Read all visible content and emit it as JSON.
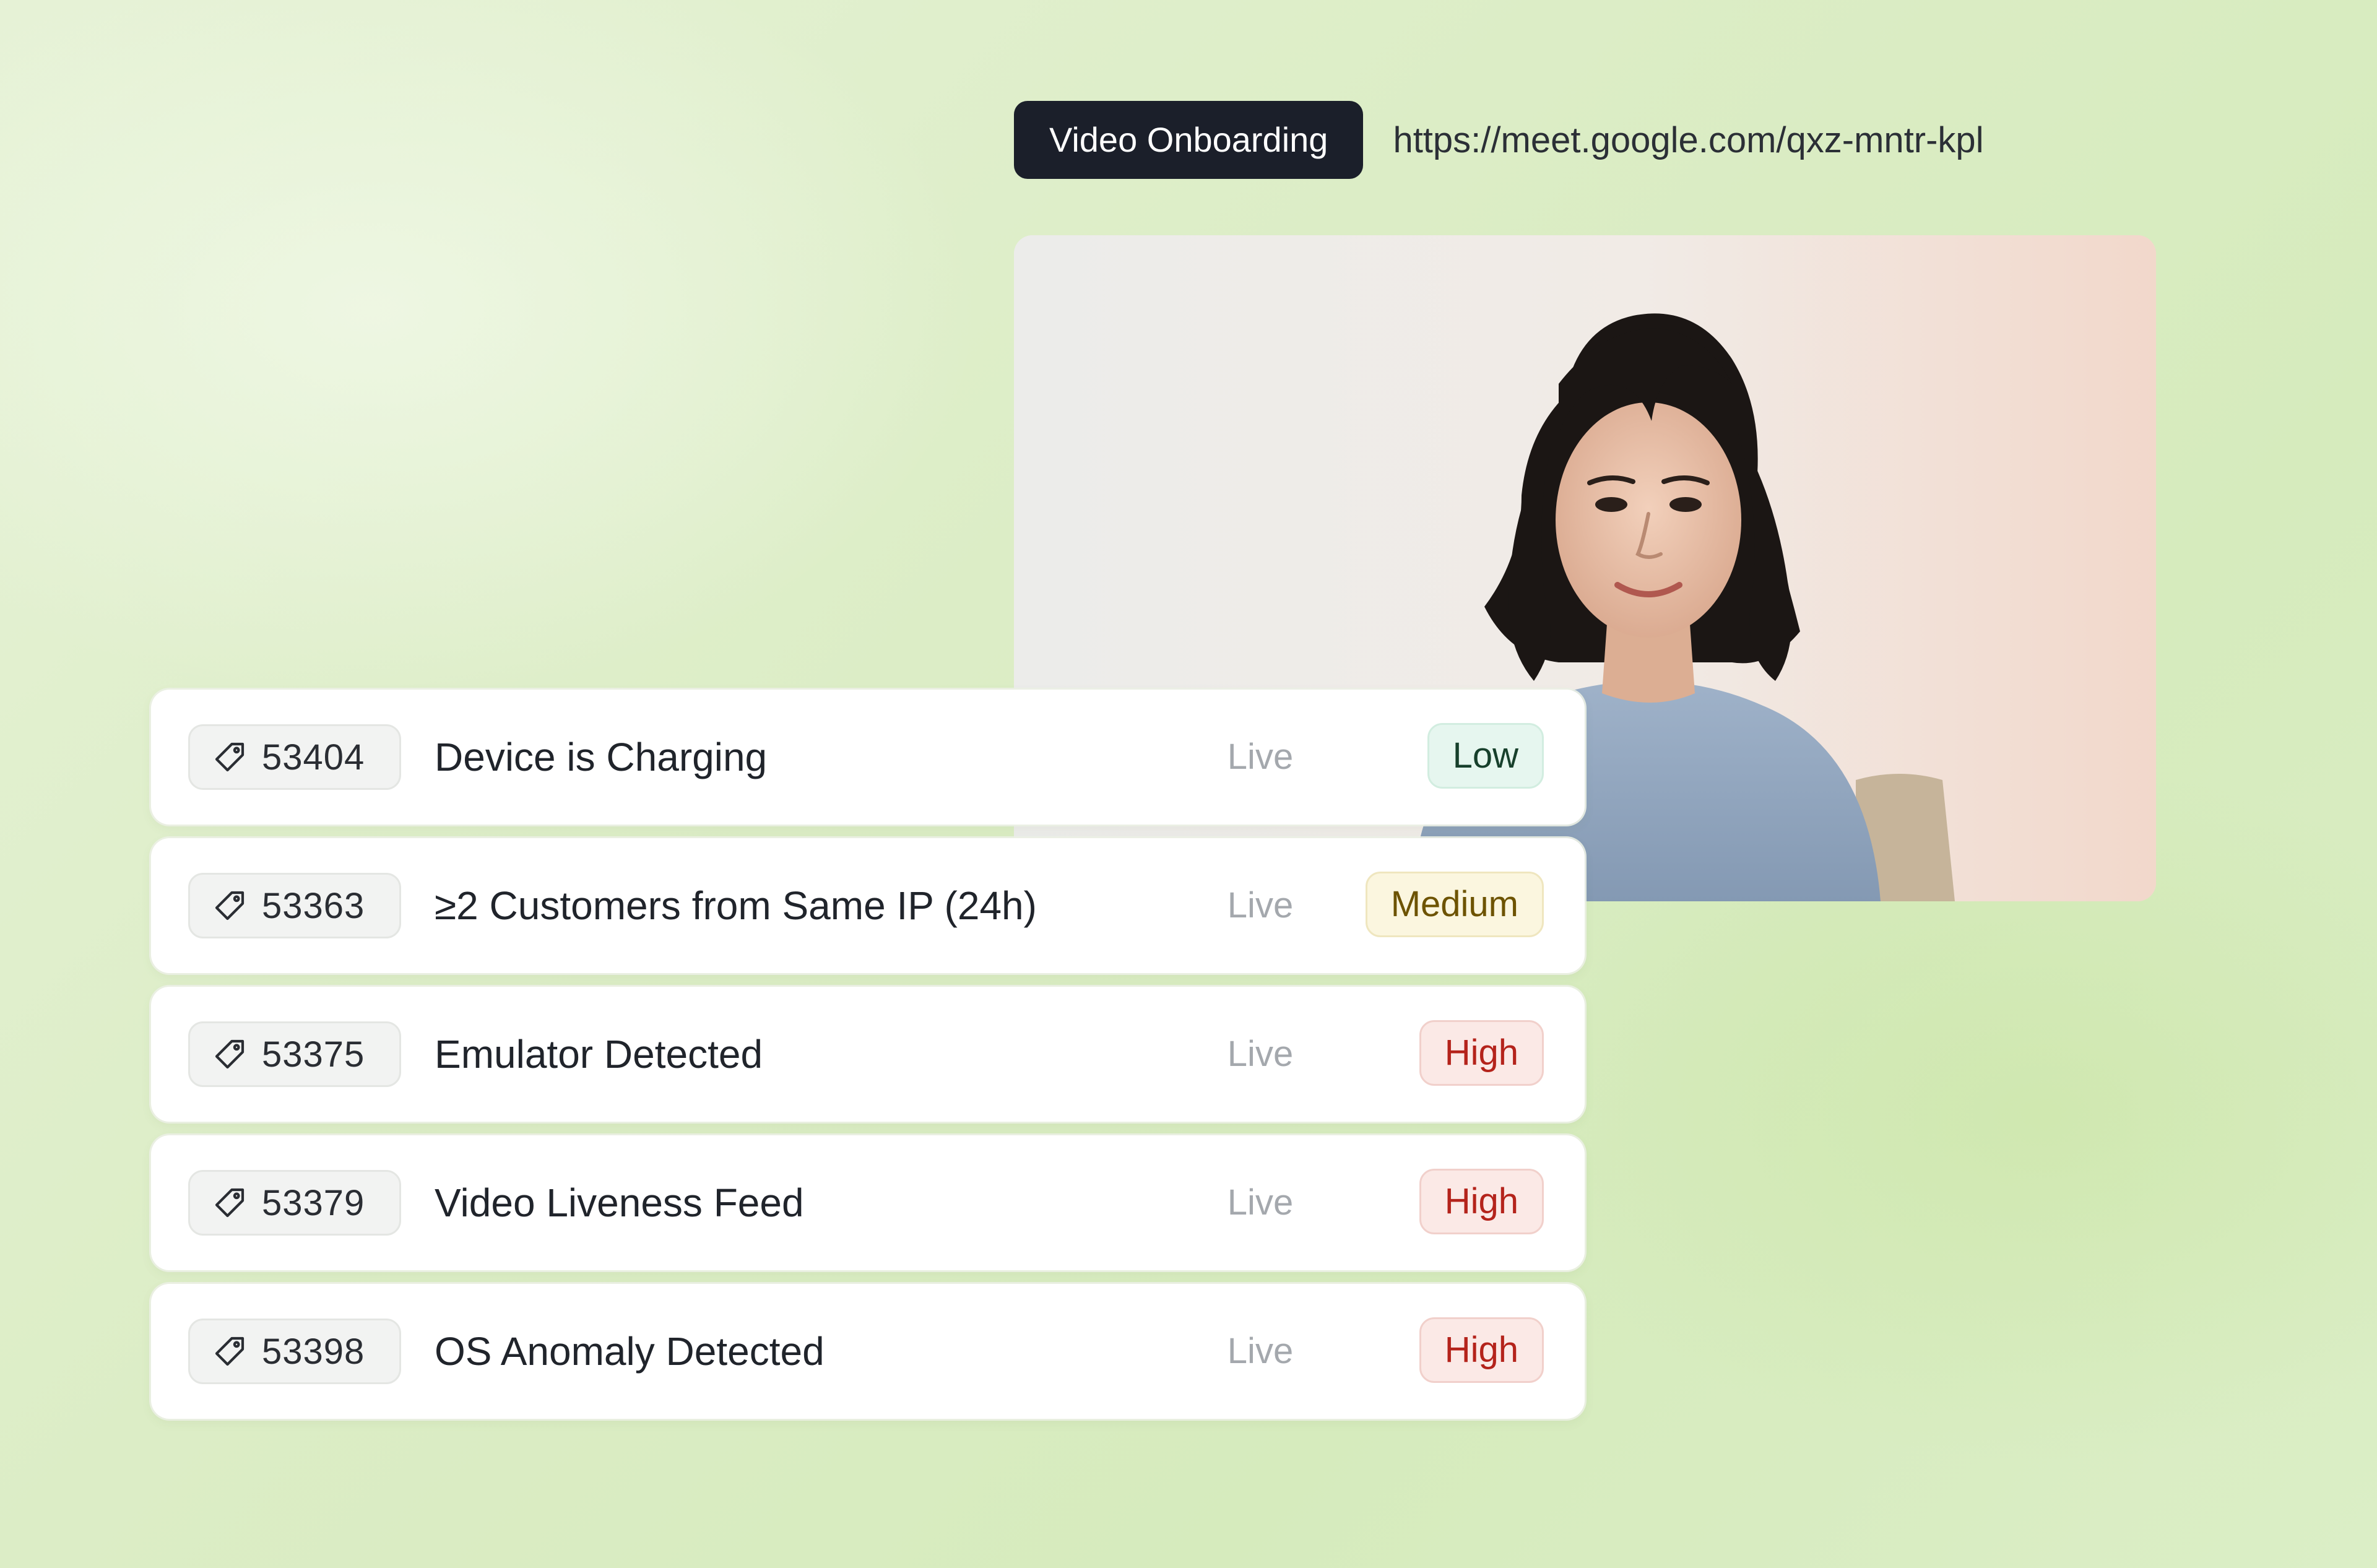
{
  "meeting": {
    "label": "Video Onboarding",
    "url": "https://meet.google.com/qxz-mntr-kpl"
  },
  "video": {
    "participant_icon": "person-video-feed"
  },
  "alerts": [
    {
      "id": "53404",
      "title": "Device is Charging",
      "status": "Live",
      "severity": "Low"
    },
    {
      "id": "53363",
      "title": "≥2 Customers from Same IP (24h)",
      "status": "Live",
      "severity": "Medium"
    },
    {
      "id": "53375",
      "title": "Emulator Detected",
      "status": "Live",
      "severity": "High"
    },
    {
      "id": "53379",
      "title": "Video Liveness Feed",
      "status": "Live",
      "severity": "High"
    },
    {
      "id": "53398",
      "title": "OS Anomaly Detected",
      "status": "Live",
      "severity": "High"
    }
  ],
  "colors": {
    "pill_bg": "#1b1f2a",
    "low": "#17402c",
    "medium": "#6d5300",
    "high": "#b4231b"
  },
  "icons": {
    "tag": "tag-icon"
  }
}
